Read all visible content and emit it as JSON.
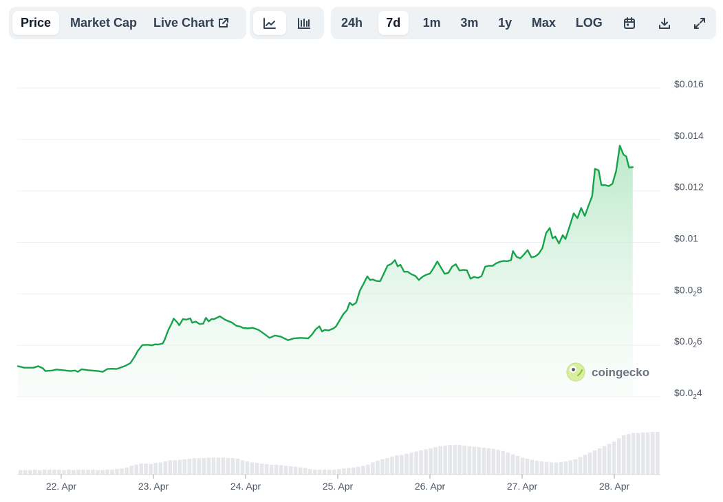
{
  "toolbar": {
    "metric_tabs": [
      {
        "label": "Price",
        "active": true
      },
      {
        "label": "Market Cap",
        "active": false
      },
      {
        "label": "Live Chart",
        "active": false,
        "icon": "external-link-icon"
      }
    ],
    "view_toggles": [
      {
        "icon": "line-chart-icon",
        "active": true
      },
      {
        "icon": "candlestick-icon",
        "active": false
      }
    ],
    "ranges": [
      {
        "label": "24h",
        "active": false
      },
      {
        "label": "7d",
        "active": true
      },
      {
        "label": "1m",
        "active": false
      },
      {
        "label": "3m",
        "active": false
      },
      {
        "label": "1y",
        "active": false
      },
      {
        "label": "Max",
        "active": false
      },
      {
        "label": "LOG",
        "active": false
      }
    ],
    "actions": [
      {
        "icon": "calendar-icon"
      },
      {
        "icon": "download-icon"
      },
      {
        "icon": "expand-icon"
      }
    ]
  },
  "watermark": {
    "text": "coingecko",
    "icon": "coingecko-logo-icon"
  },
  "colors": {
    "line": "#16a34a",
    "area_top": "#b7e8c6",
    "volume": "#e5e7eb",
    "grid": "#eef0f3",
    "axis_text": "#4b5563"
  },
  "chart_data": {
    "type": "area",
    "x_tick_labels": [
      "22. Apr",
      "23. Apr",
      "24. Apr",
      "25. Apr",
      "26. Apr",
      "27. Apr",
      "28. Apr"
    ],
    "y_tick_labels": [
      {
        "value": 0.016,
        "main": "$0.016",
        "sub": ""
      },
      {
        "value": 0.014,
        "main": "$0.014",
        "sub": ""
      },
      {
        "value": 0.012,
        "main": "$0.012",
        "sub": ""
      },
      {
        "value": 0.01,
        "main": "$0.01",
        "sub": ""
      },
      {
        "value": 0.008,
        "main": "$0.0",
        "sub": "2",
        "tail": "8"
      },
      {
        "value": 0.006,
        "main": "$0.0",
        "sub": "2",
        "tail": "6"
      },
      {
        "value": 0.004,
        "main": "$0.0",
        "sub": "2",
        "tail": "4"
      }
    ],
    "ylim": [
      0.004,
      0.016
    ],
    "xlim": [
      21.5,
      28.5
    ],
    "grid": true,
    "price": [
      [
        21.5,
        0.00519
      ],
      [
        21.6,
        0.00513
      ],
      [
        21.7,
        0.00513
      ],
      [
        21.75,
        0.00519
      ],
      [
        21.8,
        0.00511
      ],
      [
        21.83,
        0.005
      ],
      [
        21.9,
        0.00502
      ],
      [
        21.95,
        0.00506
      ],
      [
        22.05,
        0.00502
      ],
      [
        22.1,
        0.005
      ],
      [
        22.15,
        0.00502
      ],
      [
        22.18,
        0.00497
      ],
      [
        22.22,
        0.00507
      ],
      [
        22.3,
        0.00503
      ],
      [
        22.4,
        0.005
      ],
      [
        22.45,
        0.00497
      ],
      [
        22.5,
        0.00508
      ],
      [
        22.55,
        0.00509
      ],
      [
        22.6,
        0.00508
      ],
      [
        22.7,
        0.00521
      ],
      [
        22.75,
        0.00531
      ],
      [
        22.8,
        0.00558
      ],
      [
        22.83,
        0.00578
      ],
      [
        22.88,
        0.00601
      ],
      [
        22.92,
        0.00602
      ],
      [
        22.95,
        0.00602
      ],
      [
        22.98,
        0.006
      ],
      [
        23.02,
        0.00604
      ],
      [
        23.05,
        0.00603
      ],
      [
        23.1,
        0.00607
      ],
      [
        23.12,
        0.0062
      ],
      [
        23.16,
        0.00658
      ],
      [
        23.2,
        0.00687
      ],
      [
        23.22,
        0.00704
      ],
      [
        23.26,
        0.00689
      ],
      [
        23.28,
        0.00678
      ],
      [
        23.32,
        0.00702
      ],
      [
        23.36,
        0.007
      ],
      [
        23.4,
        0.00705
      ],
      [
        23.42,
        0.00688
      ],
      [
        23.46,
        0.00692
      ],
      [
        23.5,
        0.00683
      ],
      [
        23.54,
        0.00684
      ],
      [
        23.57,
        0.00707
      ],
      [
        23.6,
        0.00693
      ],
      [
        23.63,
        0.00702
      ],
      [
        23.66,
        0.00702
      ],
      [
        23.72,
        0.00713
      ],
      [
        23.78,
        0.00699
      ],
      [
        23.85,
        0.00689
      ],
      [
        23.9,
        0.00676
      ],
      [
        23.94,
        0.00673
      ],
      [
        23.98,
        0.00667
      ],
      [
        24.02,
        0.00666
      ],
      [
        24.08,
        0.00668
      ],
      [
        24.14,
        0.0066
      ],
      [
        24.2,
        0.00645
      ],
      [
        24.26,
        0.00629
      ],
      [
        24.32,
        0.00638
      ],
      [
        24.38,
        0.00634
      ],
      [
        24.46,
        0.0062
      ],
      [
        24.52,
        0.00627
      ],
      [
        24.6,
        0.00629
      ],
      [
        24.68,
        0.00627
      ],
      [
        24.72,
        0.00642
      ],
      [
        24.76,
        0.00662
      ],
      [
        24.8,
        0.00674
      ],
      [
        24.83,
        0.00654
      ],
      [
        24.86,
        0.0066
      ],
      [
        24.9,
        0.00658
      ],
      [
        24.95,
        0.00665
      ],
      [
        24.98,
        0.00673
      ],
      [
        25.02,
        0.00697
      ],
      [
        25.06,
        0.00721
      ],
      [
        25.1,
        0.00737
      ],
      [
        25.13,
        0.00766
      ],
      [
        25.16,
        0.00756
      ],
      [
        25.2,
        0.00766
      ],
      [
        25.24,
        0.00813
      ],
      [
        25.28,
        0.00839
      ],
      [
        25.32,
        0.00868
      ],
      [
        25.35,
        0.00854
      ],
      [
        25.38,
        0.00856
      ],
      [
        25.42,
        0.0085
      ],
      [
        25.46,
        0.00849
      ],
      [
        25.5,
        0.00879
      ],
      [
        25.54,
        0.0091
      ],
      [
        25.58,
        0.00916
      ],
      [
        25.62,
        0.00931
      ],
      [
        25.65,
        0.00907
      ],
      [
        25.68,
        0.00913
      ],
      [
        25.72,
        0.00886
      ],
      [
        25.76,
        0.00886
      ],
      [
        25.8,
        0.00876
      ],
      [
        25.84,
        0.0087
      ],
      [
        25.88,
        0.00854
      ],
      [
        25.92,
        0.00867
      ],
      [
        25.96,
        0.00874
      ],
      [
        26.0,
        0.00879
      ],
      [
        26.04,
        0.00901
      ],
      [
        26.08,
        0.00926
      ],
      [
        26.12,
        0.00902
      ],
      [
        26.16,
        0.00878
      ],
      [
        26.2,
        0.00882
      ],
      [
        26.24,
        0.00906
      ],
      [
        26.28,
        0.00915
      ],
      [
        26.32,
        0.00891
      ],
      [
        26.36,
        0.00893
      ],
      [
        26.4,
        0.00892
      ],
      [
        26.44,
        0.00859
      ],
      [
        26.48,
        0.00866
      ],
      [
        26.52,
        0.00862
      ],
      [
        26.56,
        0.00869
      ],
      [
        26.6,
        0.00906
      ],
      [
        26.64,
        0.00909
      ],
      [
        26.68,
        0.00909
      ],
      [
        26.72,
        0.00919
      ],
      [
        26.76,
        0.00925
      ],
      [
        26.8,
        0.00928
      ],
      [
        26.84,
        0.00927
      ],
      [
        26.88,
        0.00931
      ],
      [
        26.9,
        0.00966
      ],
      [
        26.94,
        0.00944
      ],
      [
        26.98,
        0.00938
      ],
      [
        27.02,
        0.00953
      ],
      [
        27.06,
        0.0097
      ],
      [
        27.1,
        0.00942
      ],
      [
        27.14,
        0.00945
      ],
      [
        27.18,
        0.00956
      ],
      [
        27.22,
        0.00978
      ],
      [
        27.26,
        0.01036
      ],
      [
        27.3,
        0.01056
      ],
      [
        27.33,
        0.01016
      ],
      [
        27.36,
        0.01023
      ],
      [
        27.4,
        0.00996
      ],
      [
        27.44,
        0.01028
      ],
      [
        27.47,
        0.01013
      ],
      [
        27.52,
        0.01068
      ],
      [
        27.56,
        0.01113
      ],
      [
        27.6,
        0.01094
      ],
      [
        27.64,
        0.01134
      ],
      [
        27.68,
        0.01103
      ],
      [
        27.72,
        0.01143
      ],
      [
        27.76,
        0.0118
      ],
      [
        27.79,
        0.01286
      ],
      [
        27.83,
        0.0128
      ],
      [
        27.86,
        0.01223
      ],
      [
        27.9,
        0.01223
      ],
      [
        27.94,
        0.01219
      ],
      [
        27.98,
        0.01228
      ],
      [
        28.02,
        0.01278
      ],
      [
        28.06,
        0.01376
      ],
      [
        28.1,
        0.01341
      ],
      [
        28.13,
        0.01334
      ],
      [
        28.16,
        0.01291
      ],
      [
        28.2,
        0.01292
      ]
    ],
    "volume": [
      8,
      8,
      8,
      9,
      8,
      9,
      9,
      9,
      9,
      8,
      9,
      8,
      9,
      9,
      9,
      9,
      8,
      8,
      9,
      9,
      10,
      11,
      13,
      16,
      18,
      20,
      20,
      19,
      21,
      22,
      24,
      26,
      26,
      27,
      28,
      29,
      30,
      30,
      30,
      31,
      31,
      31,
      31,
      30,
      30,
      29,
      26,
      24,
      22,
      21,
      20,
      19,
      18,
      18,
      17,
      16,
      15,
      14,
      13,
      12,
      10,
      9,
      9,
      9,
      9,
      9,
      10,
      11,
      12,
      13,
      14,
      16,
      18,
      22,
      25,
      28,
      30,
      33,
      35,
      36,
      38,
      40,
      42,
      44,
      46,
      48,
      50,
      52,
      53,
      54,
      54,
      54,
      53,
      52,
      51,
      50,
      49,
      48,
      47,
      45,
      43,
      40,
      37,
      34,
      31,
      29,
      27,
      25,
      24,
      23,
      22,
      22,
      23,
      24,
      26,
      28,
      32,
      36,
      40,
      44,
      48,
      52,
      56,
      60,
      66,
      72,
      74,
      76,
      76,
      77,
      77,
      78,
      78
    ]
  }
}
